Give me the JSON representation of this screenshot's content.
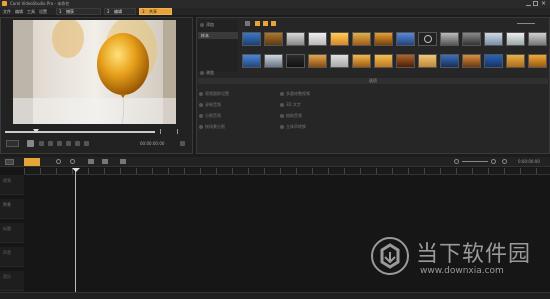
{
  "window": {
    "title": "Corel VideoStudio Pro - 未命名"
  },
  "menu": [
    "文件",
    "编辑",
    "工具",
    "设置"
  ],
  "workflow_tabs": [
    {
      "num": "1",
      "label": "捕获"
    },
    {
      "num": "2",
      "label": "编辑"
    },
    {
      "num": "3",
      "label": "共享"
    }
  ],
  "library": {
    "folder_label": "样本",
    "add_label": "添加",
    "browse_label": "浏览",
    "options_header": "选项",
    "options_left": [
      "视频跟踪设置",
      "录制音频",
      "分割音频",
      "按场景分割"
    ],
    "options_right": [
      "多重修整视频",
      "3D 文字",
      "抽取音频",
      "立体声转换"
    ]
  },
  "player": {
    "timecode": "00:00:00:00"
  },
  "timeline": {
    "timecode": "0:00:00:00",
    "tracks": [
      "视频",
      "覆叠",
      "标题",
      "声音",
      "音乐"
    ]
  },
  "watermark": {
    "brand": "当下软件园",
    "url": "www.downxia.com"
  },
  "colors": {
    "accent": "#e8a33a",
    "background": "#1c1c1c",
    "panel": "#262626"
  }
}
